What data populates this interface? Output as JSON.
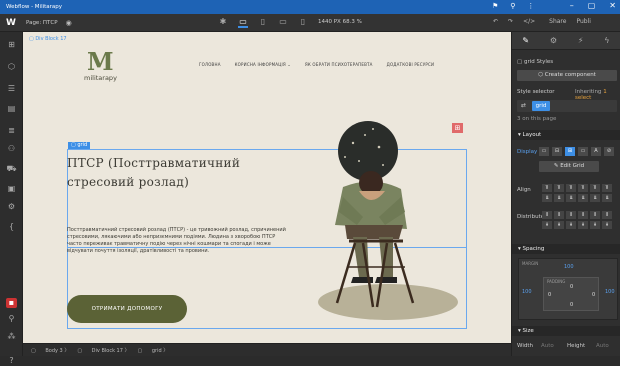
{
  "window": {
    "title": "Webflow - Militarapy"
  },
  "topbar": {
    "logo": "W",
    "page_label": "Page: ПТСР",
    "size_info": "1440 PX  68.3 %",
    "share": "Share",
    "publish": "Publi"
  },
  "canvas": {
    "div_tag": "Div Block 17",
    "logo_mark": "M",
    "logo_text": "militarapy",
    "nav": [
      "ГОЛОВНА",
      "КОРИСНА ІНФОРМАЦІЯ  ⌄",
      "ЯК ОБРАТИ ПСИХОТЕРАПЕВТА",
      "ДОДАТКОВІ РЕСУРСИ"
    ],
    "grid_tag": "grid",
    "hero_title": "ПТСР (Посттравматичний стресовий розлад)",
    "hero_text": "Посттравматичний стресовий розлад (ПТСР) - це тривожний розлад, спричинений стресовими, лякаючими або непризємними подіями. Людина з хворобою ПТСР часто переживає травматичну подію через нічні кошмари та спогади і може відчувати почуття ізоляції, дратівливості та провини.",
    "cta_label": "ОТРИМАТИ ДОПОМОГУ"
  },
  "breadcrumb": [
    "Body 3",
    "Div Block 17",
    "grid"
  ],
  "rpanel": {
    "grid_styles": "grid Styles",
    "create_component": "Create component",
    "style_selector": "Style selector",
    "inheriting": "Inheriting",
    "inheriting_count": "1 select",
    "selected_class": "grid",
    "on_this_page": "3 on this page",
    "layout_section": "Layout",
    "display_label": "Display",
    "edit_grid": "Edit Grid",
    "align_label": "Align",
    "distribute_label": "Distribute",
    "spacing_section": "Spacing",
    "margin_label": "MARGIN",
    "margin_top": "100",
    "margin_left": "100",
    "margin_right": "100",
    "padding_label": "PADDING",
    "padding_vals": [
      "0",
      "0",
      "0",
      "0"
    ],
    "size_section": "Size",
    "width_label": "Width",
    "width_val": "Auto",
    "height_label": "Height",
    "height_val": "Auto"
  },
  "colors": {
    "accent": "#3d8fe6",
    "brand_green": "#5b6236",
    "canvas_bg": "#ece7dc",
    "titlebar": "#1e63b5"
  }
}
